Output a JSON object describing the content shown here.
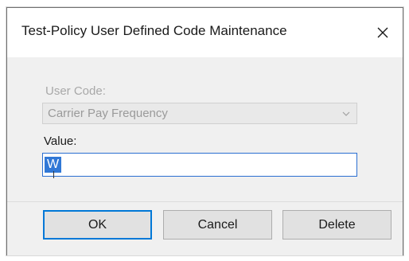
{
  "dialog": {
    "title": "Test-Policy User Defined Code Maintenance",
    "close_icon": "close-icon"
  },
  "form": {
    "user_code_label": "User Code:",
    "user_code_value": "Carrier Pay Frequency",
    "user_code_enabled": false,
    "dropdown_icon": "chevron-down-icon",
    "value_label": "Value:",
    "value_text": "W",
    "value_selected": true
  },
  "buttons": {
    "ok_label": "OK",
    "cancel_label": "Cancel",
    "delete_label": "Delete"
  },
  "colors": {
    "accent": "#0078d7",
    "selection": "#3178d6"
  }
}
